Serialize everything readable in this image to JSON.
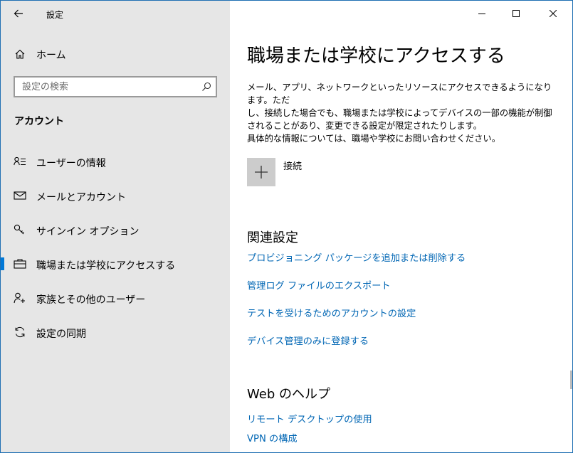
{
  "window": {
    "app_title": "設定"
  },
  "sidebar": {
    "home_label": "ホーム",
    "search_placeholder": "設定の検索",
    "section_title": "アカウント",
    "items": [
      {
        "label": "ユーザーの情報",
        "icon": "user-info-icon"
      },
      {
        "label": "メールとアカウント",
        "icon": "mail-icon"
      },
      {
        "label": "サインイン オプション",
        "icon": "key-icon"
      },
      {
        "label": "職場または学校にアクセスする",
        "icon": "briefcase-icon",
        "active": true
      },
      {
        "label": "家族とその他のユーザー",
        "icon": "add-person-icon"
      },
      {
        "label": "設定の同期",
        "icon": "sync-icon"
      }
    ]
  },
  "main": {
    "title": "職場または学校にアクセスする",
    "description": [
      "メール、アプリ、ネットワークといったリソースにアクセスできるようになります。ただ",
      "し、接続した場合でも、職場または学校によってデバイスの一部の機能が制御",
      "されることがあり、変更できる設定が限定されたりします。",
      "具体的な情報については、職場や学校にお問い合わせください。"
    ],
    "connect_label": "接続",
    "related_title": "関連設定",
    "related_links": [
      "プロビジョニング パッケージを追加または削除する",
      "管理ログ ファイルのエクスポート",
      "テストを受けるためのアカウントの設定",
      "デバイス管理のみに登録する"
    ],
    "web_help_title": "Web のヘルプ",
    "web_help_links": [
      "リモート デスクトップの使用",
      "VPN の構成"
    ]
  },
  "colors": {
    "accent": "#0078d7",
    "link": "#0066b4",
    "sidebar_bg": "#e6e6e6"
  }
}
